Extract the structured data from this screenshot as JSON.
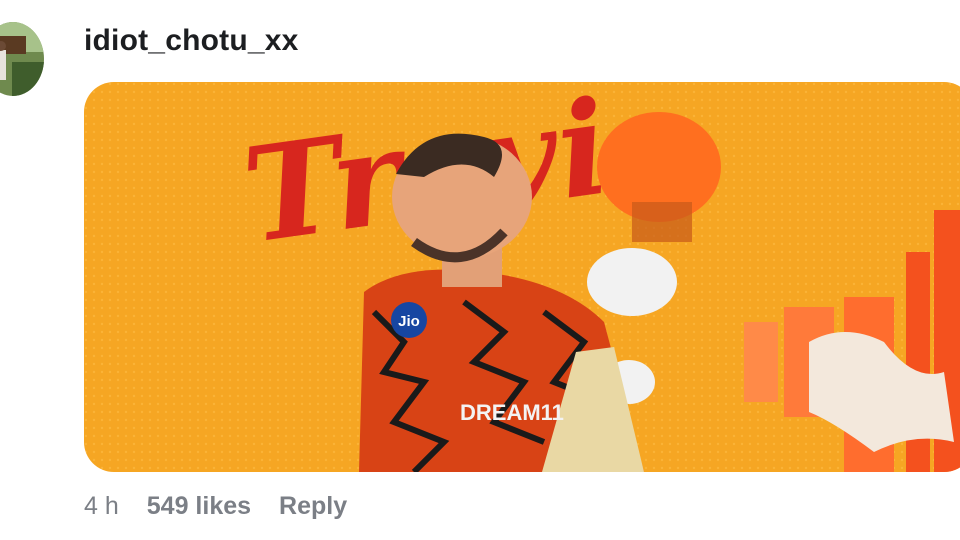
{
  "comment": {
    "username": "idiot_chotu_xx",
    "image_text": {
      "script_name": "Travis",
      "jersey_logo": "Jio",
      "jersey_sponsor": "DREAM11"
    },
    "meta": {
      "time": "4 h",
      "likes": "549 likes",
      "reply": "Reply"
    }
  },
  "colors": {
    "username": "#1c1e21",
    "meta_text": "#7b7f86",
    "image_background": "#f6a623",
    "script_text": "#d7261e"
  }
}
